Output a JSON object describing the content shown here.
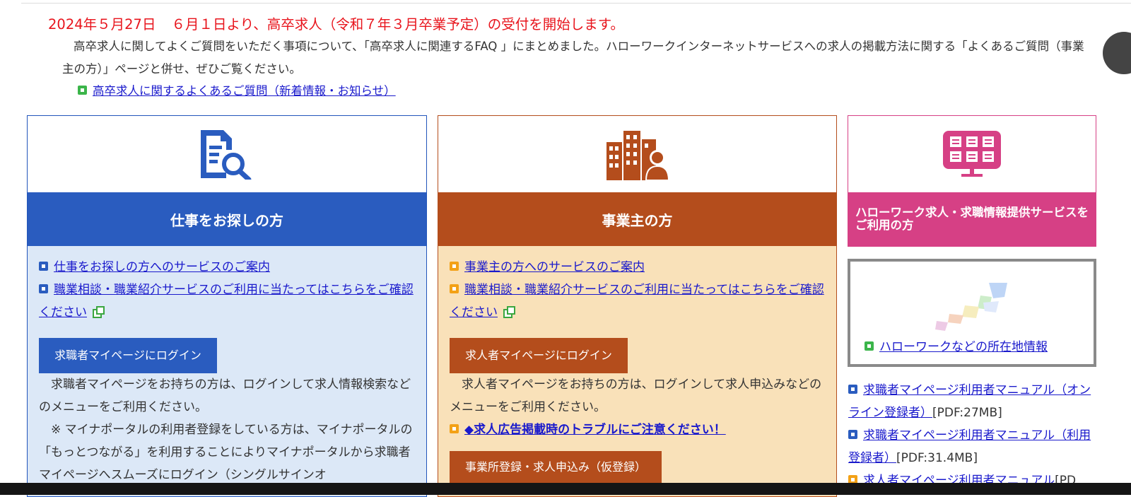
{
  "news": {
    "date": "2024年５月27日",
    "headline": "６月１日より、高卒求人（令和７年３月卒業予定）の受付を開始します。",
    "body": "高卒求人に関してよくご質問をいただく事項について、「高卒求人に関連するFAQ 」にまとめました。ハローワークインターネットサービスへの求人の掲載方法に関する「よくあるご質問（事業主の方）」ページと併せ、ぜひご覧ください。",
    "faq_link": "高卒求人に関するよくあるご質問（新着情報・お知らせ）"
  },
  "job_seekers": {
    "title": "仕事をお探しの方",
    "link1": "仕事をお探しの方へのサービスのご案内",
    "link2": "職業相談・職業紹介サービスのご利用に当たってはこちらをご確認ください",
    "login_button": "求職者マイページにログイン",
    "desc1": "求職者マイページをお持ちの方は、ログインして求人情報検索などのメニューをご利用ください。",
    "desc2": "※ マイナポータルの利用者登録をしている方は、マイナポータルの「もっとつながる」を利用することによりマイナポータルから求職者マイページへスムーズにログイン（シングルサインオ"
  },
  "employers": {
    "title": "事業主の方",
    "link1": "事業主の方へのサービスのご案内",
    "link2": "職業相談・職業紹介サービスのご利用に当たってはこちらをご確認ください",
    "login_button": "求人者マイページにログイン",
    "desc1": "求人者マイページをお持ちの方は、ログインして求人申込みなどのメニューをご利用ください。",
    "warning_link": "◆求人広告掲載時のトラブルにご注意ください！",
    "register_button": "事業所登録・求人申込み（仮登録）"
  },
  "info_service": {
    "title": "ハローワーク求人・求職情報提供サービスをご利用の方",
    "map_link": "ハローワークなどの所在地情報",
    "manual1_link": "求職者マイページ利用者マニュアル（オンライン登録者）",
    "manual1_size": "[PDF:27MB]",
    "manual2_link": "求職者マイページ利用者マニュアル（利用登録者）",
    "manual2_size": "[PDF:31.4MB]",
    "manual3_link": "求人者マイページ利用者マニュアル",
    "manual3_size": "[PD"
  },
  "colors": {
    "job_seekers": "#2a5cbf",
    "employers": "#b44d1c",
    "info_service": "#d64085",
    "news_red": "#e8141c",
    "link": "#1a1acc"
  },
  "icons": [
    "document-search-icon",
    "building-person-icon",
    "monitor-grid-icon",
    "japan-map-icon",
    "external-link-icon"
  ]
}
